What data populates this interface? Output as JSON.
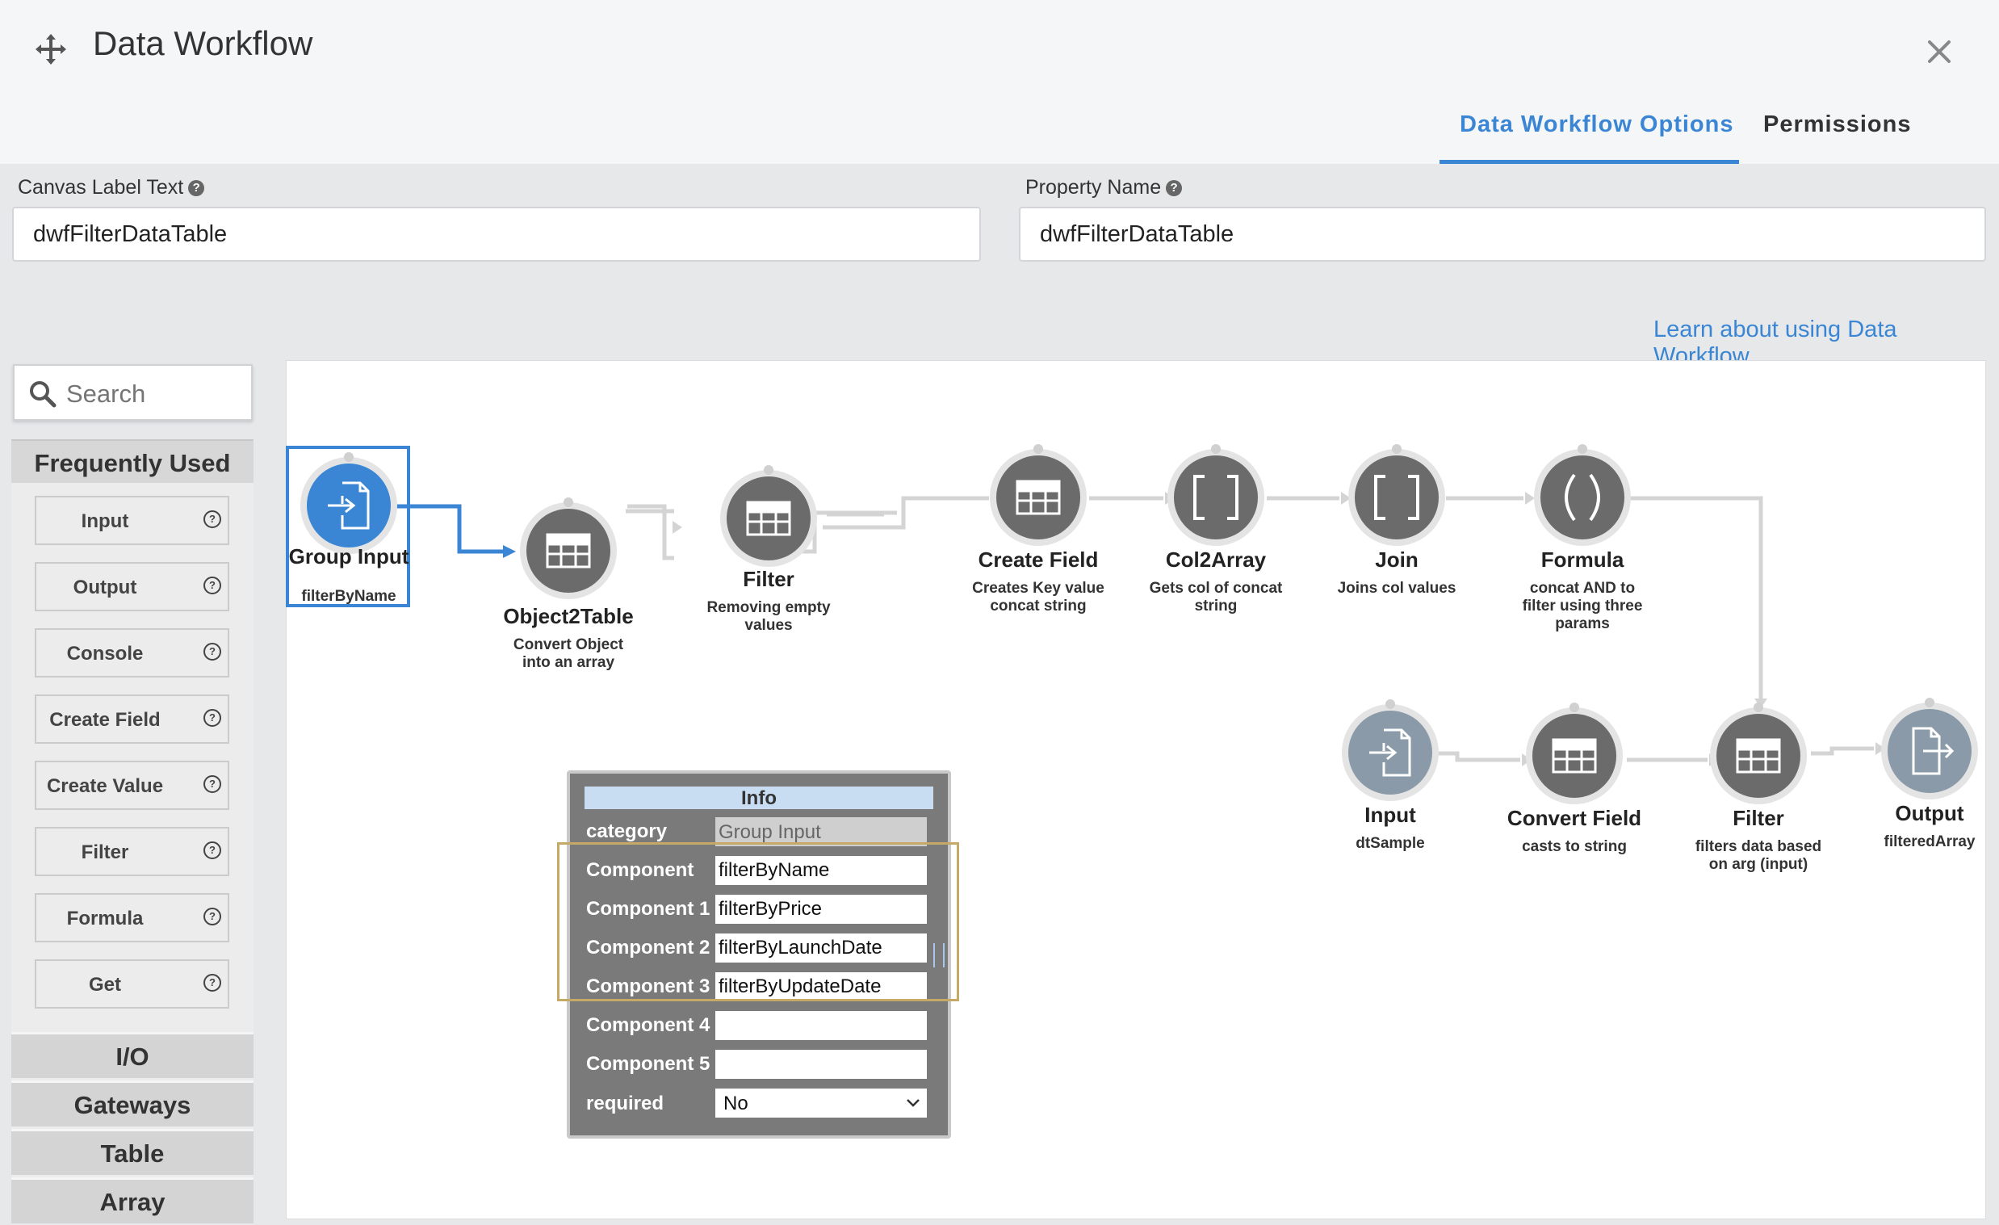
{
  "header": {
    "title": "Data Workflow",
    "tabs": [
      {
        "label": "Data Workflow Options",
        "active": true
      },
      {
        "label": "Permissions",
        "active": false
      }
    ],
    "icons": {
      "move": "move-icon",
      "close": "close-icon"
    }
  },
  "fields": {
    "canvas_label": {
      "label": "Canvas Label Text",
      "value": "dwfFilterDataTable"
    },
    "property_name": {
      "label": "Property Name",
      "value": "dwfFilterDataTable"
    }
  },
  "help_glyph": "?",
  "learn_link": "Learn about using Data Workflow",
  "palette": {
    "search_placeholder": "Search",
    "frequently_used": "Frequently Used",
    "items": [
      {
        "label": "Input"
      },
      {
        "label": "Output"
      },
      {
        "label": "Console"
      },
      {
        "label": "Create Field"
      },
      {
        "label": "Create Value"
      },
      {
        "label": "Filter"
      },
      {
        "label": "Formula"
      },
      {
        "label": "Get"
      }
    ],
    "categories": [
      "I/O",
      "Gateways",
      "Table",
      "Array"
    ]
  },
  "nodes": [
    {
      "id": "group-input",
      "title": "Group Input",
      "sub": "filterByName",
      "icon": "file-import-icon",
      "color": "#3a86d4",
      "selected": true
    },
    {
      "id": "object2table",
      "title": "Object2Table",
      "sub": "Convert Object into an array",
      "icon": "table-icon"
    },
    {
      "id": "filter1",
      "title": "Filter",
      "sub": "Removing empty values",
      "icon": "table-icon"
    },
    {
      "id": "create-field",
      "title": "Create Field",
      "sub": "Creates Key value concat string",
      "icon": "table-icon"
    },
    {
      "id": "col2array",
      "title": "Col2Array",
      "sub": "Gets col of concat string",
      "icon": "brackets-icon"
    },
    {
      "id": "join",
      "title": "Join",
      "sub": "Joins col values",
      "icon": "brackets-icon"
    },
    {
      "id": "formula",
      "title": "Formula",
      "sub": "concat AND to filter using three params",
      "icon": "parens-icon"
    },
    {
      "id": "input",
      "title": "Input",
      "sub": "dtSample",
      "icon": "file-import-icon",
      "color": "#8a9aa8"
    },
    {
      "id": "convert-field",
      "title": "Convert Field",
      "sub": "casts to string",
      "icon": "table-icon"
    },
    {
      "id": "filter2",
      "title": "Filter",
      "sub": "filters data based on arg (input)",
      "icon": "table-icon"
    },
    {
      "id": "output",
      "title": "Output",
      "sub": "filteredArray",
      "icon": "file-export-icon",
      "color": "#8a9aa8"
    }
  ],
  "info": {
    "title": "Info",
    "rows": [
      {
        "label": "category",
        "value": "Group Input",
        "readonly": true
      },
      {
        "label": "Component",
        "value": "filterByName"
      },
      {
        "label": "Component 1",
        "value": "filterByPrice"
      },
      {
        "label": "Component 2",
        "value": "filterByLaunchDate"
      },
      {
        "label": "Component 3",
        "value": "filterByUpdateDate"
      },
      {
        "label": "Component 4",
        "value": ""
      },
      {
        "label": "Component 5",
        "value": ""
      }
    ],
    "required": {
      "label": "required",
      "value": "No"
    }
  },
  "colors": {
    "accent": "#3a86d4",
    "node_gray": "#6b6b6b",
    "highlight": "#c5a966"
  }
}
